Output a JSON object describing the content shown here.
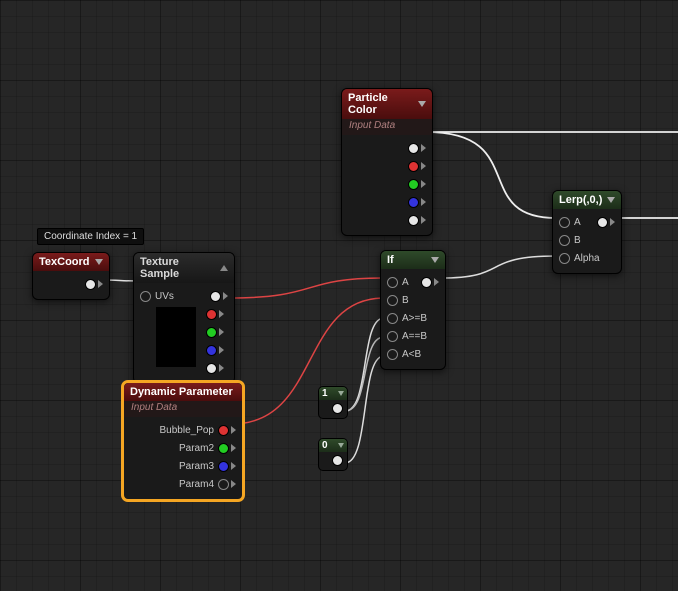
{
  "tooltip": {
    "coord": "Coordinate Index = 1"
  },
  "nodes": {
    "texcoord": {
      "title": "TexCoord"
    },
    "texsample": {
      "title": "Texture Sample",
      "inputs": {
        "uvs": "UVs"
      }
    },
    "particlecolor": {
      "title": "Particle Color",
      "subtitle": "Input Data"
    },
    "dynparam": {
      "title": "Dynamic Parameter",
      "subtitle": "Input Data",
      "outputs": {
        "p1": "Bubble_Pop",
        "p2": "Param2",
        "p3": "Param3",
        "p4": "Param4"
      }
    },
    "ifnode": {
      "title": "If",
      "inputs": {
        "a": "A",
        "b": "B",
        "ageb": "A>=B",
        "aeqb": "A==B",
        "alb": "A<B"
      }
    },
    "const1": {
      "value": "1"
    },
    "const0": {
      "value": "0"
    },
    "lerp": {
      "title": "Lerp(,0,)",
      "inputs": {
        "a": "A",
        "b": "B",
        "alpha": "Alpha"
      }
    }
  }
}
